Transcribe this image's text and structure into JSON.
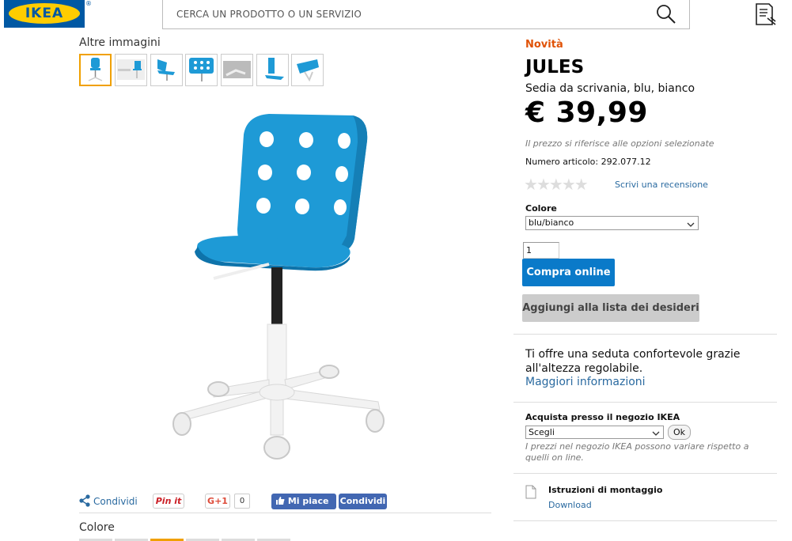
{
  "header": {
    "logo_text": "IKEA",
    "logo_mark": "®",
    "search_placeholder": "CERCA UN PRODOTTO O UN SERVIZIO",
    "icons": [
      "search-icon",
      "shopping-list-icon"
    ]
  },
  "gallery": {
    "label": "Altre immagini",
    "thumbnail_count": 7,
    "selected_index": 0
  },
  "share": {
    "share_label": "Condividi",
    "pinit_label": "Pin it",
    "gplus_label": "G+1",
    "gplus_count": "0",
    "fb_like_label": "Mi piace 0",
    "fb_share_label": "Condividi"
  },
  "bottom": {
    "color_heading": "Colore"
  },
  "product": {
    "badge": "Novità",
    "name": "JULES",
    "description": "Sedia da scrivania, blu, bianco",
    "price": "€ 39,99",
    "price_note": "Il prezzo si riferisce alle opzioni selezionate",
    "article_number": "Numero articolo: 292.077.12",
    "rating_stars": 0,
    "write_review": "Scrivi una recensione",
    "color_label": "Colore",
    "color_selected": "blu/bianco",
    "quantity": "1",
    "buy_button": "Compra online",
    "wishlist_button": "Aggiungi alla lista dei desideri",
    "summary": "Ti offre una seduta confortevole grazie all'altezza regolabile.",
    "more_info": "Maggiori informazioni"
  },
  "store": {
    "label": "Acquista presso il negozio IKEA",
    "select_value": "Scegli",
    "ok_button": "Ok",
    "note": "I prezzi nel negozio IKEA possono variare rispetto a quelli on line."
  },
  "assembly": {
    "label": "Istruzioni di montaggio",
    "download": "Download"
  },
  "colors": {
    "accent_blue": "#0a7ac9",
    "badge_orange": "#e05206",
    "link_blue": "#2a6aa0",
    "chair_blue": "#1e9ad6"
  }
}
